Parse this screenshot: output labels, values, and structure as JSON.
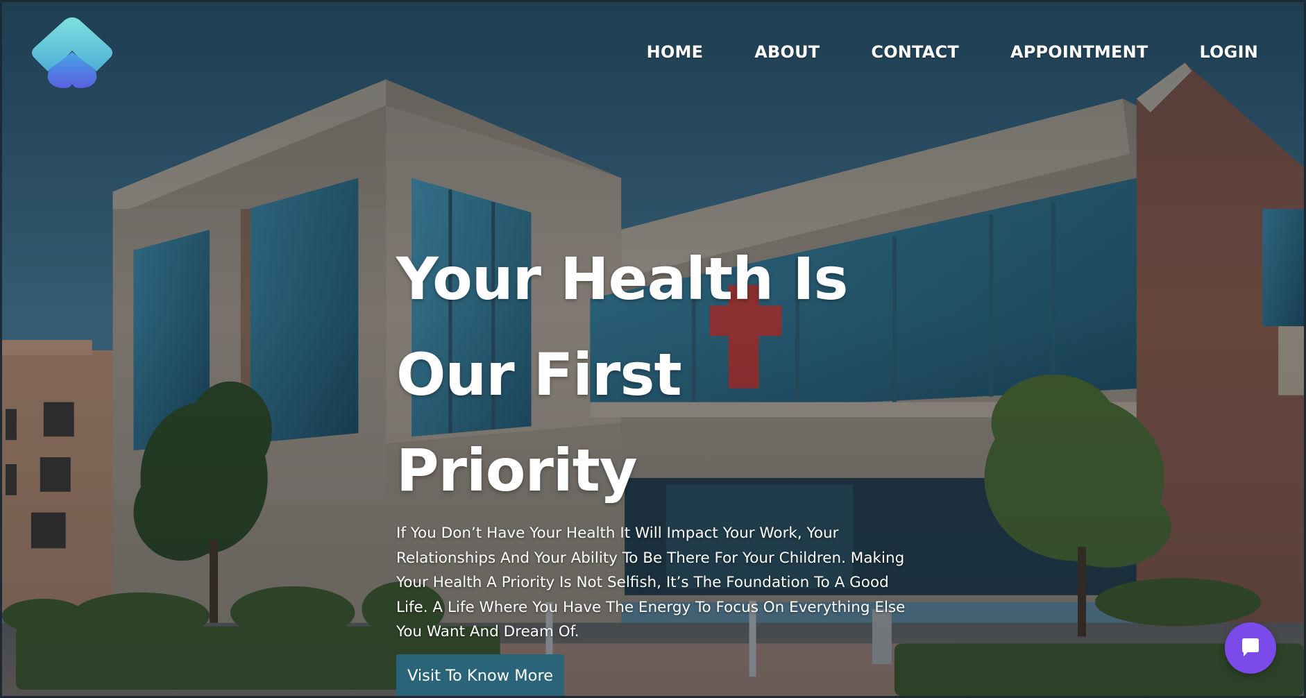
{
  "brand": {
    "logo_icon": "droplet-diamond-logo",
    "logo_colors": [
      "#6dd0d9",
      "#5b6fe3"
    ]
  },
  "nav": {
    "items": [
      {
        "label": "HOME"
      },
      {
        "label": "ABOUT"
      },
      {
        "label": "CONTACT"
      },
      {
        "label": "APPOINTMENT"
      },
      {
        "label": "LOGIN"
      }
    ]
  },
  "hero": {
    "title_line1": "Your Health Is",
    "title_line2": "Our First Priority",
    "description": "If You Don’t Have Your Health It Will Impact Your Work, Your Relationships And Your Ability To Be There For Your Children. Making Your Health A Priority Is Not Selfish, It’s The Foundation To A Good Life. A Life Where You Have The Energy To Focus On Everything Else You Want And Dream Of.",
    "cta_label": "Visit To Know More",
    "background": "hospital-building-photo"
  },
  "chat": {
    "icon": "chat-bubble-icon"
  },
  "colors": {
    "cta": "#2a6478",
    "chat": "#7b4bea",
    "text": "#ffffff"
  }
}
